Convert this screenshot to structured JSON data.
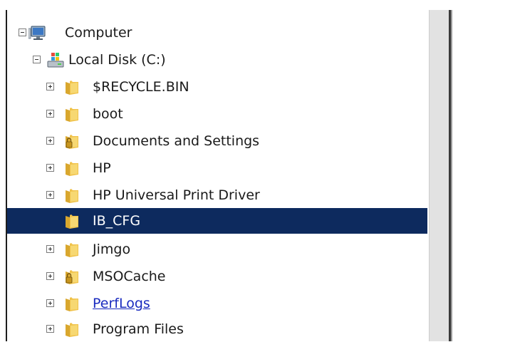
{
  "tree": {
    "root": {
      "label": "Computer",
      "icon": "computer-icon",
      "expanded": true
    },
    "drive": {
      "label": "Local Disk (C:)",
      "icon": "drive-icon",
      "expanded": true
    },
    "folders": [
      {
        "label": "$RECYCLE.BIN",
        "icon": "folder-icon",
        "expandable": true
      },
      {
        "label": "boot",
        "icon": "folder-icon",
        "expandable": true
      },
      {
        "label": "Documents and Settings",
        "icon": "locked-folder-icon",
        "expandable": true
      },
      {
        "label": "HP",
        "icon": "folder-icon",
        "expandable": true
      },
      {
        "label": "HP Universal Print Driver",
        "icon": "folder-icon",
        "expandable": true
      },
      {
        "label": "IB_CFG",
        "icon": "folder-icon",
        "expandable": false,
        "selected": true
      },
      {
        "label": "Jimgo",
        "icon": "folder-icon",
        "expandable": true
      },
      {
        "label": "MSOCache",
        "icon": "locked-folder-icon",
        "expandable": true
      },
      {
        "label": "PerfLogs",
        "icon": "folder-icon",
        "expandable": true,
        "hovered": true
      },
      {
        "label": "Program Files",
        "icon": "folder-icon",
        "expandable": true
      }
    ]
  },
  "colors": {
    "selection": "#0d2a5e",
    "link": "#1a2bbf",
    "folder": "#f0c24a"
  }
}
